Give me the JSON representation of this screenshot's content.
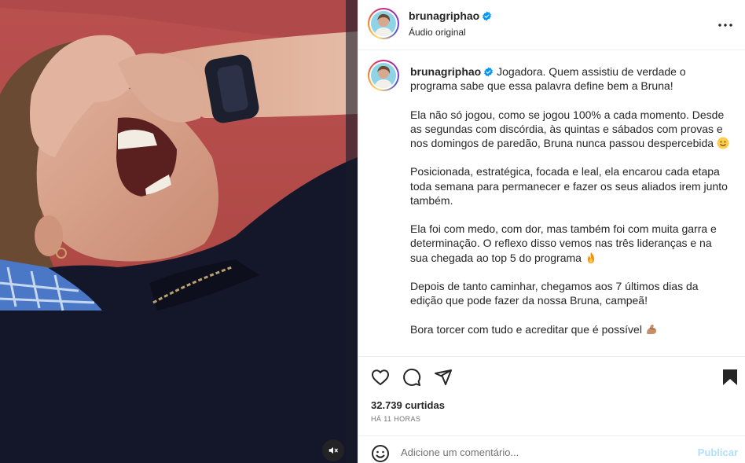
{
  "media": {
    "description_icon": "video",
    "mute_icon": "speaker-muted-icon"
  },
  "header": {
    "username": "brunagriphao",
    "subtitle": "Áudio original",
    "verified_icon": "verified-badge-icon",
    "more_icon": "more-options-icon"
  },
  "caption": {
    "username": "brunagriphao",
    "paragraphs": [
      "Jogadora. Quem assistiu de verdade o programa sabe que essa palavra define bem a Bruna!",
      "Ela não só jogou, como se jogou 100% a cada momento. Desde as segundas com discórdia, às quintas e sábados com provas e nos domingos de paredão, Bruna nunca passou despercebida",
      "Posicionada, estratégica, focada e leal, ela encarou cada etapa toda semana para permanecer e fazer os seus aliados irem junto também.",
      "Ela foi com medo, com dor, mas também foi com muita garra e determinação. O reflexo disso vemos nas três lideranças e na sua chegada ao top 5 do programa",
      "Depois de tanto caminhar, chegamos aos 7 últimos dias da edição que pode fazer da nossa Bruna, campeã!",
      "Bora torcer com tudo e acreditar que é possível"
    ],
    "emojis": [
      "smiling-face-emoji",
      "fire-emoji",
      "flexed-biceps-emoji"
    ]
  },
  "actions": {
    "like_icon": "heart-icon",
    "comment_icon": "comment-icon",
    "share_icon": "share-icon",
    "save_icon": "bookmark-icon"
  },
  "likes": "32.739 curtidas",
  "time_ago": "HÁ 11 HORAS",
  "comment": {
    "placeholder": "Adicione um comentário...",
    "post_label": "Publicar",
    "emoji_icon": "smiley-icon"
  },
  "colors": {
    "verified": "#0095f6",
    "publish_disabled": "#b2dffc",
    "border": "#efefef",
    "muted_text": "#737373"
  }
}
